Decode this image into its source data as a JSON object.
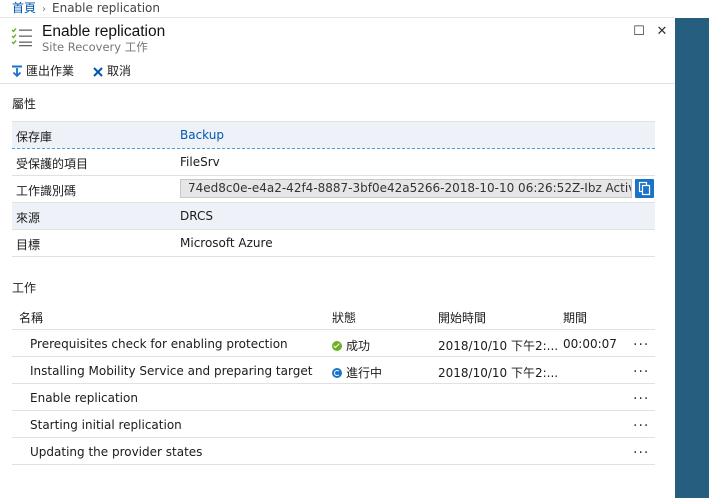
{
  "breadcrumb": {
    "home": "首頁",
    "sep": "›",
    "current": "Enable replication"
  },
  "header": {
    "title": "Enable replication",
    "subtitle": "Site Recovery 工作",
    "maximize": "☐",
    "close": "✕"
  },
  "toolbar": {
    "export_label": "匯出作業",
    "cancel_label": "取消"
  },
  "properties": {
    "section_title": "屬性",
    "rows": [
      {
        "key": "保存庫",
        "value": "Backup"
      },
      {
        "key": "受保護的項目",
        "value": "FileSrv"
      },
      {
        "key": "工作識別碼",
        "value": "74ed8c0e-e4a2-42f4-8887-3bf0e42a5266-2018-10-10 06:26:52Z-Ibz Activit..."
      },
      {
        "key": "來源",
        "value": "DRCS"
      },
      {
        "key": "目標",
        "value": "Microsoft Azure"
      }
    ]
  },
  "jobs": {
    "section_title": "工作",
    "columns": {
      "name": "名稱",
      "status": "狀態",
      "start": "開始時間",
      "duration": "期間"
    },
    "rows": [
      {
        "name": "Prerequisites check for enabling protection",
        "status": "成功",
        "status_type": "success",
        "start": "2018/10/10 下午2:...",
        "duration": "00:00:07",
        "more": "..."
      },
      {
        "name": "Installing Mobility Service and preparing target",
        "status": "進行中",
        "status_type": "in-progress",
        "start": "2018/10/10 下午2:...",
        "duration": "",
        "more": "..."
      },
      {
        "name": "Enable replication",
        "status": "",
        "start": "",
        "duration": "",
        "more": "..."
      },
      {
        "name": "Starting initial replication",
        "status": "",
        "start": "",
        "duration": "",
        "more": "..."
      },
      {
        "name": "Updating the provider states",
        "status": "",
        "start": "",
        "duration": "",
        "more": "..."
      }
    ]
  },
  "colors": {
    "accent": "#0058ad",
    "side_band": "#265e80",
    "success": "#6cb022",
    "running": "#1a73c9"
  }
}
